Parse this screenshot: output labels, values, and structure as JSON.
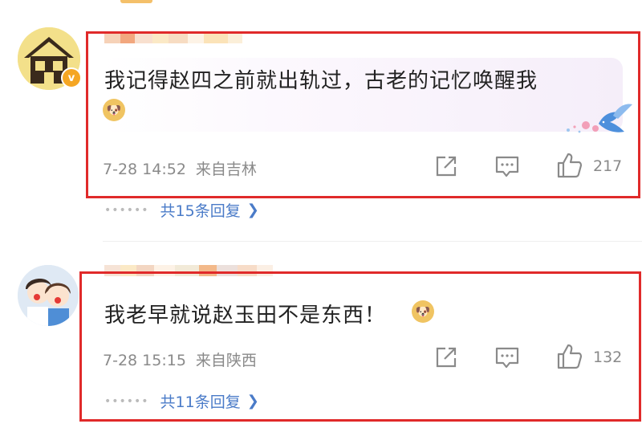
{
  "comments": [
    {
      "text": "我记得赵四之前就出轨过，古老的记忆唤醒我",
      "time": "7-28 14:52",
      "source": "来自吉林",
      "like_count": "217",
      "reply_label": "共15条回复",
      "has_verified_badge": true,
      "verified_badge": "v"
    },
    {
      "text": "我老早就说赵玉田不是东西！",
      "time": "7-28 15:15",
      "source": "来自陕西",
      "like_count": "132",
      "reply_label": "共11条回复",
      "has_verified_badge": false
    }
  ],
  "icons": {
    "share": "share-icon",
    "comment": "comment-icon",
    "like": "thumbs-up-icon",
    "emoji": "doge-emoji-icon",
    "reply_chevron": "chevron-right-icon"
  },
  "colors": {
    "highlight_box": "#e02a2a",
    "reply_link": "#4a7bc8",
    "meta_text": "#8a8a8a",
    "verified_badge": "#f5a623"
  }
}
